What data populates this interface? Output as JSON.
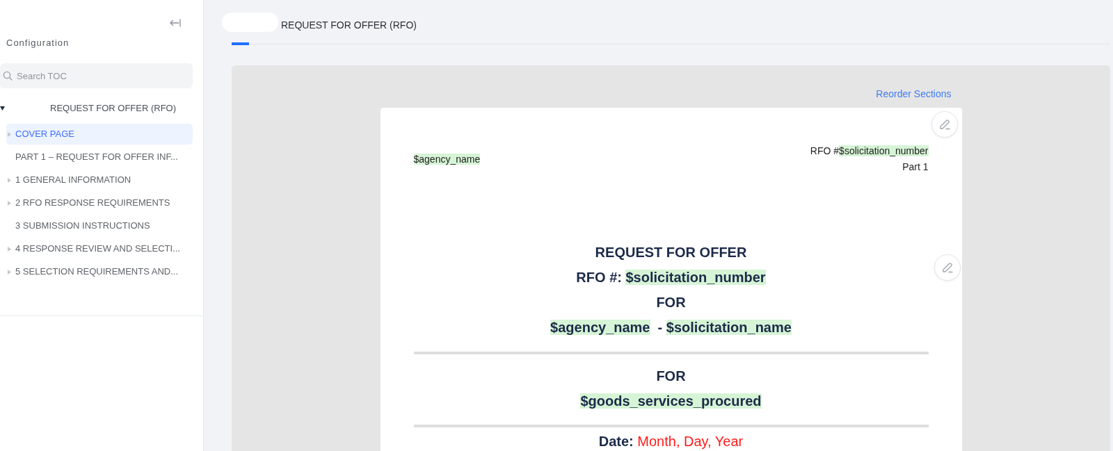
{
  "sidebar": {
    "title": "Configuration",
    "search": {
      "placeholder": "Search TOC"
    },
    "toc": [
      {
        "label": "REQUEST FOR OFFER (RFO)",
        "expanded": true,
        "selected": false,
        "children": [
          {
            "label": "COVER PAGE",
            "expandable": true,
            "expanded": false,
            "selected": true
          },
          {
            "label": "PART 1 – REQUEST FOR OFFER INF...",
            "expandable": false,
            "expanded": false,
            "selected": false
          },
          {
            "label": "1 GENERAL INFORMATION",
            "expandable": true,
            "expanded": false,
            "selected": false
          },
          {
            "label": "2 RFO RESPONSE REQUIREMENTS",
            "expandable": true,
            "expanded": false,
            "selected": false
          },
          {
            "label": "3 SUBMISSION INSTRUCTIONS",
            "expandable": false,
            "expanded": false,
            "selected": false
          },
          {
            "label": "4 RESPONSE REVIEW AND SELECTI...",
            "expandable": true,
            "expanded": false,
            "selected": false
          },
          {
            "label": "5 SELECTION REQUIREMENTS AND...",
            "expandable": true,
            "expanded": false,
            "selected": false
          }
        ]
      }
    ]
  },
  "tabs": [
    {
      "label": "REQUEST FOR OFFER (RFO)",
      "selected": true
    }
  ],
  "document": {
    "reorder_link": "Reorder Sections",
    "header": {
      "left": [
        {
          "segments": [
            {
              "text": "$agency_name",
              "kind": "variable"
            }
          ]
        }
      ],
      "right": [
        {
          "segments": [
            {
              "text": "RFO #",
              "kind": "plain"
            },
            {
              "text": "$solicitation_number",
              "kind": "variable"
            }
          ]
        },
        {
          "segments": [
            {
              "text": "Part 1",
              "kind": "plain"
            }
          ]
        }
      ]
    },
    "blocks": [
      {
        "lines": [
          {
            "segments": [
              {
                "text": "REQUEST FOR OFFER",
                "kind": "plain"
              }
            ]
          },
          {
            "segments": [
              {
                "text": "RFO #: ",
                "kind": "plain"
              },
              {
                "text": "$solicitation_number",
                "kind": "variable"
              }
            ]
          },
          {
            "segments": [
              {
                "text": "FOR",
                "kind": "plain"
              }
            ]
          },
          {
            "segments": [
              {
                "text": "$agency_name",
                "kind": "variable"
              },
              {
                "text": "  - ",
                "kind": "plain"
              },
              {
                "text": "$solicitation_name",
                "kind": "variable"
              }
            ]
          }
        ]
      },
      {
        "lines": [
          {
            "segments": [
              {
                "text": "FOR",
                "kind": "plain"
              }
            ]
          },
          {
            "segments": [
              {
                "text": "$goods_services_procured",
                "kind": "variable"
              }
            ]
          }
        ]
      },
      {
        "lines": [
          {
            "segments": [
              {
                "text": "Date: ",
                "kind": "plain"
              },
              {
                "text": "Month, Day, Year",
                "kind": "fill"
              }
            ]
          }
        ]
      }
    ]
  }
}
